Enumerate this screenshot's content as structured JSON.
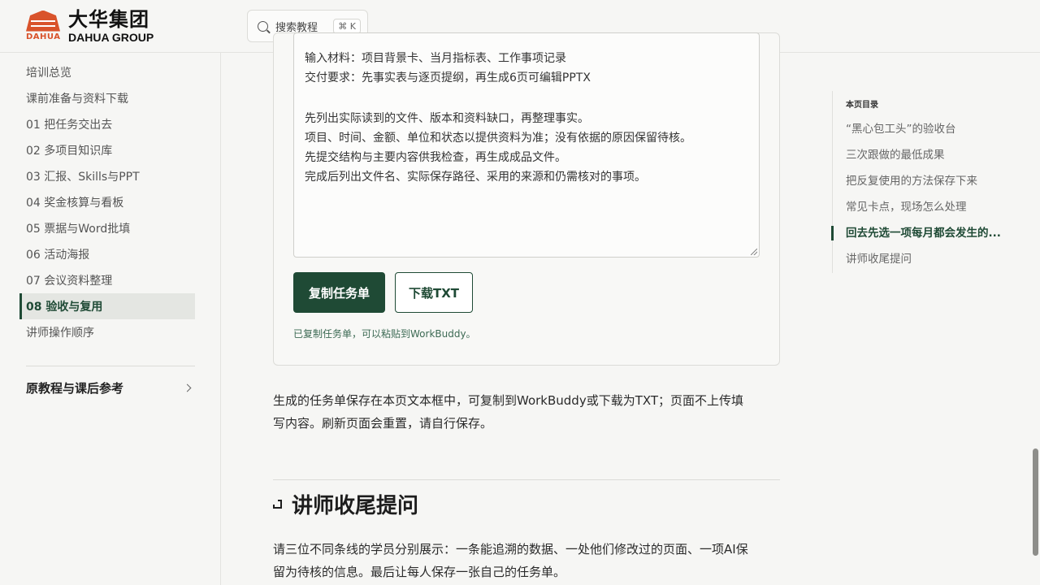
{
  "header": {
    "logo_cn": "大华集团",
    "logo_en": "DAHUA GROUP",
    "logo_small": "DAHUA",
    "search_label": "搜索教程",
    "search_shortcut": "⌘ K"
  },
  "sidebar": {
    "items": [
      {
        "label": "培训总览"
      },
      {
        "label": "课前准备与资料下载"
      },
      {
        "label": "01 把任务交出去"
      },
      {
        "label": "02 多项目知识库"
      },
      {
        "label": "03 汇报、Skills与PPT"
      },
      {
        "label": "04 奖金核算与看板"
      },
      {
        "label": "05 票据与Word批填"
      },
      {
        "label": "06 活动海报"
      },
      {
        "label": "07 会议资料整理"
      },
      {
        "label": "08 验收与复用",
        "active": true
      },
      {
        "label": "讲师操作顺序"
      }
    ],
    "section_label": "原教程与课后参考"
  },
  "main": {
    "task_lines": [
      "输入材料：项目背景卡、当月指标表、工作事项记录",
      "交付要求：先事实表与逐页提纲，再生成6页可编辑PPTX",
      "",
      "先列出实际读到的文件、版本和资料缺口，再整理事实。",
      "项目、时间、金额、单位和状态以提供资料为准；没有依据的原因保留待核。",
      "先提交结构与主要内容供我检查，再生成成品文件。",
      "完成后列出文件名、实际保存路径、采用的来源和仍需核对的事项。"
    ],
    "copy_button": "复制任务单",
    "download_button": "下载TXT",
    "copy_status": "已复制任务单，可以粘贴到WorkBuddy。",
    "note_line1": "生成的任务单保存在本页文本框中，可复制到WorkBuddy或下载为TXT；页面不上传填",
    "note_line2": "写内容。刷新页面会重置，请自行保存。",
    "section_heading": "讲师收尾提问",
    "closing_line1": "请三位不同条线的学员分别展示：一条能追溯的数据、一处他们修改过的页面、一项AI保",
    "closing_line2": "留为待核的信息。最后让每人保存一张自己的任务单。"
  },
  "toc": {
    "title": "本页目录",
    "items": [
      {
        "label": "“黑心包工头”的验收台"
      },
      {
        "label": "三次跟做的最低成果"
      },
      {
        "label": "把反复使用的方法保存下来"
      },
      {
        "label": "常见卡点，现场怎么处理"
      },
      {
        "label": "回去先选一项每月都会发生的...",
        "active": true
      },
      {
        "label": "讲师收尾提问"
      }
    ]
  },
  "colors": {
    "accent": "#1f4a35",
    "brand": "#d9532b",
    "background": "#f6f6f4"
  }
}
